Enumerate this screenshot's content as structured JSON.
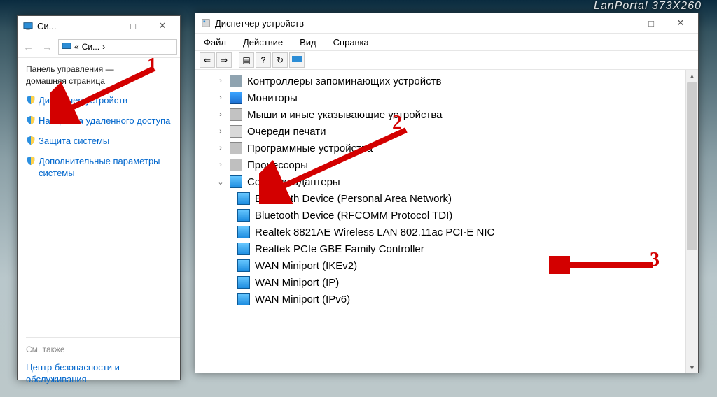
{
  "watermark": "LanPortal   373X260",
  "win1": {
    "title": "Си...",
    "breadcrumb_prefix": "«",
    "breadcrumb": "Си...",
    "breadcrumb_chevron": "›",
    "heading_l1": "Панель управления —",
    "heading_l2": "домашняя страница",
    "links": [
      "Диспетчер устройств",
      "Настройка удаленного доступа",
      "Защита системы",
      "Дополнительные параметры системы"
    ],
    "see_also": "См. также",
    "see_also_link": "Центр безопасности и обслуживания"
  },
  "win2": {
    "title": "Диспетчер устройств",
    "menu": [
      "Файл",
      "Действие",
      "Вид",
      "Справка"
    ],
    "tree": [
      {
        "expander": "chevron",
        "icon": "ic-disk",
        "label": "Контроллеры запоминающих устройств"
      },
      {
        "expander": "chevron",
        "icon": "ic-monitor",
        "label": "Мониторы"
      },
      {
        "expander": "chevron",
        "icon": "ic-generic",
        "label": "Мыши и иные указывающие устройства"
      },
      {
        "expander": "chevron",
        "icon": "ic-print",
        "label": "Очереди печати"
      },
      {
        "expander": "chevron",
        "icon": "ic-generic",
        "label": "Программные устройства"
      },
      {
        "expander": "chevron",
        "icon": "ic-chip",
        "label": "Процессоры"
      },
      {
        "expander": "down",
        "icon": "ic-net",
        "label": "Сетевые адаптеры",
        "children": [
          "Bluetooth Device (Personal Area Network)",
          "Bluetooth Device (RFCOMM Protocol TDI)",
          "Realtek 8821AE Wireless LAN 802.11ac PCI-E NIC",
          "Realtek PCIe GBE Family Controller",
          "WAN Miniport (IKEv2)",
          "WAN Miniport (IP)",
          "WAN Miniport (IPv6)"
        ]
      }
    ]
  },
  "annotations": {
    "n1": "1",
    "n2": "2",
    "n3": "3"
  }
}
